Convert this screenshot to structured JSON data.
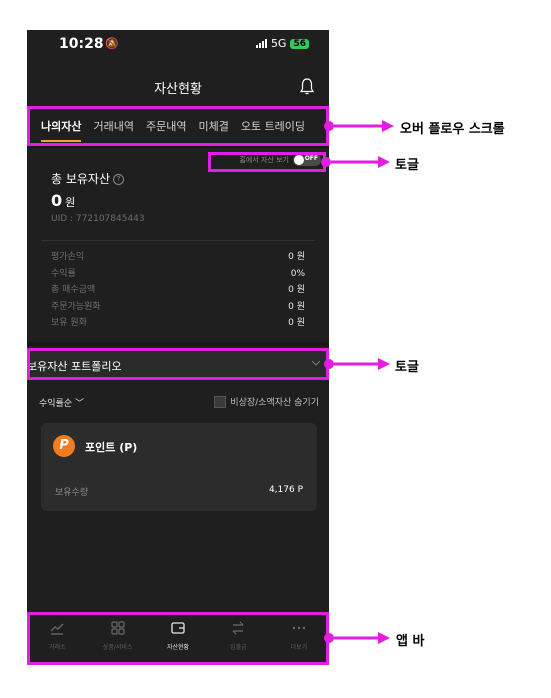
{
  "status_bar": {
    "time": "10:28",
    "network": "5G",
    "battery": "56"
  },
  "header": {
    "title": "자산현황"
  },
  "tabs": [
    "나의자산",
    "거래내역",
    "주문내역",
    "미체결",
    "오토 트레이딩"
  ],
  "home_toggle": {
    "label": "홈에서 자산 보기",
    "state": "OFF"
  },
  "summary": {
    "label": "총 보유자산",
    "value": "0",
    "unit": "원",
    "uid": "UID : 772107845443"
  },
  "stats": [
    {
      "label": "평가손익",
      "value": "0 원"
    },
    {
      "label": "수익률",
      "value": "0%"
    },
    {
      "label": "총 매수금액",
      "value": "0 원"
    },
    {
      "label": "주문가능원화",
      "value": "0 원"
    },
    {
      "label": "보유 원화",
      "value": "0 원"
    }
  ],
  "portfolio": {
    "title": "보유자산 포트폴리오"
  },
  "list_controls": {
    "sort": "수익률순",
    "hide_small": "비상장/소액자산 숨기기"
  },
  "holding": {
    "icon_letter": "P",
    "name": "포인트 (P)",
    "qty_label": "보유수량",
    "qty_value": "4,176 P"
  },
  "appbar": [
    "거래소",
    "상품/서비스",
    "자산현황",
    "입출금",
    "더보기"
  ],
  "annotations": {
    "overflow": "오버 플로우 스크롤",
    "toggle1": "토글",
    "toggle2": "토글",
    "appbar": "앱 바"
  },
  "colors": {
    "accent": "#e8a33d",
    "annotation": "#e11ee1",
    "point_icon": "#f47c20"
  }
}
